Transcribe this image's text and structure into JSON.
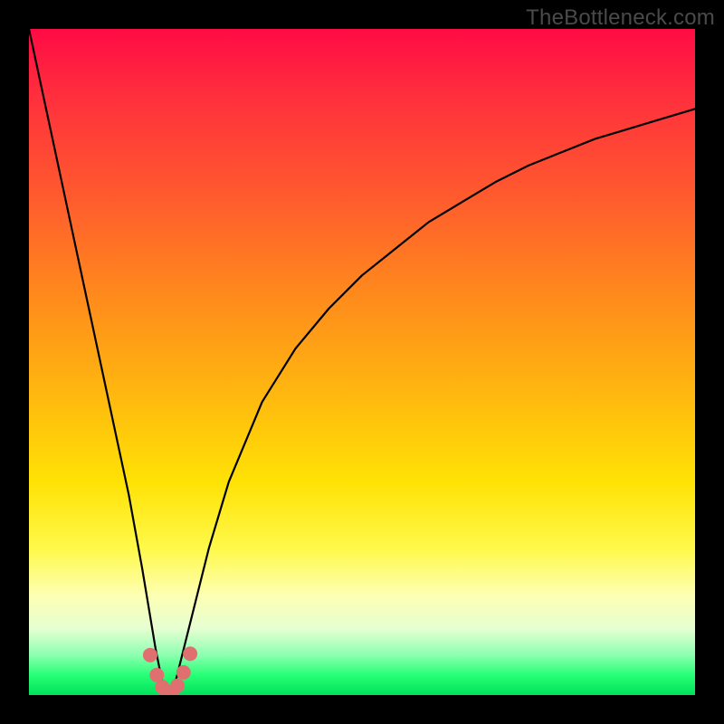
{
  "watermark": "TheBottleneck.com",
  "chart_data": {
    "type": "line",
    "title": "",
    "xlabel": "",
    "ylabel": "",
    "xlim": [
      0,
      100
    ],
    "ylim": [
      0,
      100
    ],
    "notes": "V-shaped bottleneck curve. Minimum (0%) sits near x≈21. Left branch rises steeply to ~100% at x=0. Right branch rises with diminishing slope toward ~88% at x=100. Curve values are percentages (y) estimated from the figure.",
    "series": [
      {
        "name": "bottleneck-curve",
        "x": [
          0,
          3,
          6,
          9,
          12,
          15,
          17,
          19,
          20,
          21,
          22,
          23,
          25,
          27,
          30,
          35,
          40,
          45,
          50,
          55,
          60,
          65,
          70,
          75,
          80,
          85,
          90,
          95,
          100
        ],
        "y": [
          100,
          86,
          72,
          58,
          44,
          30,
          19,
          7,
          2,
          0,
          2,
          6,
          14,
          22,
          32,
          44,
          52,
          58,
          63,
          67,
          71,
          74,
          77,
          79.5,
          81.5,
          83.5,
          85,
          86.5,
          88
        ]
      }
    ],
    "markers": {
      "name": "highlight-dots",
      "color": "#e06f6f",
      "x": [
        18.2,
        19.2,
        20.0,
        20.7,
        21.4,
        22.3,
        23.2,
        24.2
      ],
      "y": [
        6.0,
        3.0,
        1.2,
        0.4,
        0.4,
        1.4,
        3.4,
        6.2
      ]
    },
    "gradient_stops": [
      {
        "pos": 0,
        "color": "#ff0b45"
      },
      {
        "pos": 10,
        "color": "#ff2f3d"
      },
      {
        "pos": 25,
        "color": "#ff5a2e"
      },
      {
        "pos": 40,
        "color": "#ff8a1c"
      },
      {
        "pos": 55,
        "color": "#ffb80f"
      },
      {
        "pos": 68,
        "color": "#ffe205"
      },
      {
        "pos": 78,
        "color": "#fff94a"
      },
      {
        "pos": 85,
        "color": "#fdffb2"
      },
      {
        "pos": 90,
        "color": "#e6ffd2"
      },
      {
        "pos": 94,
        "color": "#8dffb0"
      },
      {
        "pos": 97,
        "color": "#27ff76"
      },
      {
        "pos": 100,
        "color": "#00e25b"
      }
    ]
  }
}
